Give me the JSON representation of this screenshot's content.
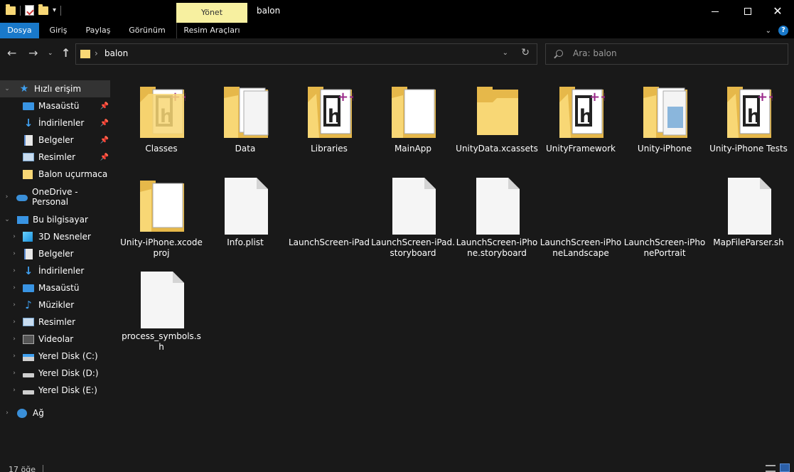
{
  "window": {
    "title": "balon",
    "contextual_tab": "Yönet",
    "controls": {
      "minimize": "minimize-icon",
      "maximize": "maximize-icon",
      "close": "close-icon"
    }
  },
  "ribbon": {
    "tabs": [
      {
        "label": "Dosya"
      },
      {
        "label": "Giriş"
      },
      {
        "label": "Paylaş"
      },
      {
        "label": "Görünüm"
      },
      {
        "label": "Resim Araçları"
      }
    ],
    "accent": "#1979ca"
  },
  "address": {
    "path": "balon",
    "search_placeholder": "Ara: balon"
  },
  "sidebar": {
    "items": [
      {
        "label": "Hızlı erişim",
        "icon": "star-icon",
        "expanded": true,
        "selected": true
      },
      {
        "label": "Masaüstü",
        "icon": "desktop-icon",
        "pinned": true
      },
      {
        "label": "İndirilenler",
        "icon": "download-icon",
        "pinned": true
      },
      {
        "label": "Belgeler",
        "icon": "document-icon",
        "pinned": true
      },
      {
        "label": "Resimler",
        "icon": "pictures-icon",
        "pinned": true
      },
      {
        "label": "Balon uçurmaca",
        "icon": "folder-icon"
      },
      {
        "label": "OneDrive - Personal",
        "icon": "cloud-icon"
      },
      {
        "label": "Bu bilgisayar",
        "icon": "computer-icon",
        "expanded": true
      },
      {
        "label": "3D Nesneler",
        "icon": "3d-objects-icon"
      },
      {
        "label": "Belgeler",
        "icon": "document-icon"
      },
      {
        "label": "İndirilenler",
        "icon": "download-icon"
      },
      {
        "label": "Masaüstü",
        "icon": "desktop-icon"
      },
      {
        "label": "Müzikler",
        "icon": "music-icon"
      },
      {
        "label": "Resimler",
        "icon": "pictures-icon"
      },
      {
        "label": "Videolar",
        "icon": "video-icon"
      },
      {
        "label": "Yerel Disk (C:)",
        "icon": "system-disk-icon"
      },
      {
        "label": "Yerel Disk (D:)",
        "icon": "disk-icon"
      },
      {
        "label": "Yerel Disk (E:)",
        "icon": "disk-icon"
      },
      {
        "label": "Ağ",
        "icon": "network-icon"
      }
    ]
  },
  "files": [
    {
      "name": "Classes",
      "type": "folder-code"
    },
    {
      "name": "Data",
      "type": "folder-docs"
    },
    {
      "name": "Libraries",
      "type": "folder-code"
    },
    {
      "name": "MainApp",
      "type": "folder-doc"
    },
    {
      "name": "UnityData.xcassets",
      "type": "folder-empty"
    },
    {
      "name": "UnityFramework",
      "type": "folder-code"
    },
    {
      "name": "Unity-iPhone",
      "type": "folder-image"
    },
    {
      "name": "Unity-iPhone Tests",
      "type": "folder-code"
    },
    {
      "name": "Unity-iPhone.xcodeproj",
      "type": "folder-doc"
    },
    {
      "name": "Info.plist",
      "type": "file"
    },
    {
      "name": "LaunchScreen-iPad",
      "type": "none"
    },
    {
      "name": "LaunchScreen-iPad.storyboard",
      "type": "file"
    },
    {
      "name": "LaunchScreen-iPhone.storyboard",
      "type": "file"
    },
    {
      "name": "LaunchScreen-iPhoneLandscape",
      "type": "none"
    },
    {
      "name": "LaunchScreen-iPhonePortrait",
      "type": "none"
    },
    {
      "name": "MapFileParser.sh",
      "type": "file"
    },
    {
      "name": "process_symbols.sh",
      "type": "file"
    }
  ],
  "status": {
    "item_count": "17 öğe"
  }
}
